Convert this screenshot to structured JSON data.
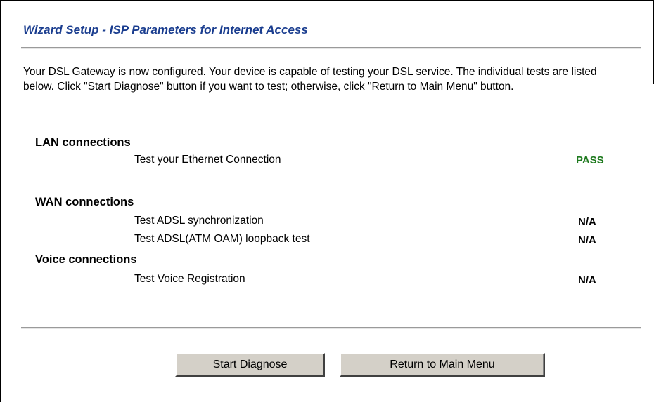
{
  "wizard": {
    "title": "Wizard Setup - ISP Parameters for Internet Access",
    "intro": "Your DSL Gateway is now configured. Your device is capable of testing your DSL service. The individual tests are listed below. Click \"Start Diagnose\" button if you want to test; otherwise, click \"Return to Main Menu\" button."
  },
  "sections": {
    "lan": {
      "title": "LAN connections",
      "tests": [
        {
          "label": "Test your Ethernet Connection",
          "result": "PASS"
        }
      ]
    },
    "wan": {
      "title": "WAN connections",
      "tests": [
        {
          "label": "Test ADSL synchronization",
          "result": "N/A"
        },
        {
          "label": "Test ADSL(ATM OAM) loopback test",
          "result": "N/A"
        }
      ]
    },
    "voice": {
      "title": "Voice connections",
      "tests": [
        {
          "label": "Test Voice Registration",
          "result": "N/A"
        }
      ]
    }
  },
  "colors": {
    "title": "#1a3d8f",
    "pass": "#1f7a1f",
    "button_face": "#d4d0c8"
  },
  "buttons": {
    "start_diagnose": "Start Diagnose",
    "return_main_menu": "Return to Main Menu"
  }
}
